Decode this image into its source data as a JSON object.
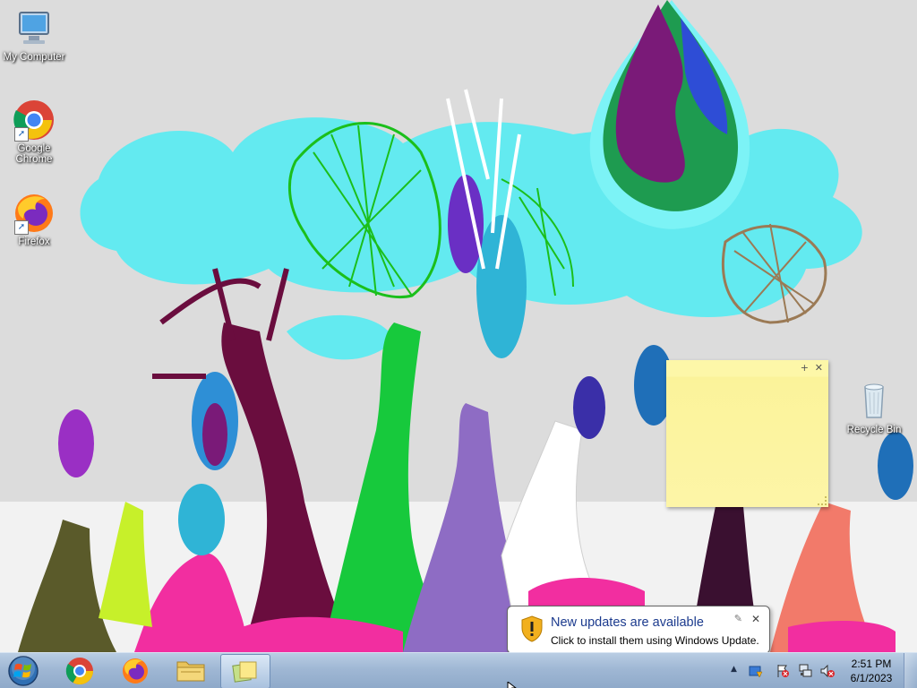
{
  "desktop": {
    "icons": [
      {
        "label": "My Computer",
        "icon": "computer-icon"
      },
      {
        "label": "Google Chrome",
        "icon": "chrome-icon"
      },
      {
        "label": "Firefox",
        "icon": "firefox-icon"
      },
      {
        "label": "Recycle Bin",
        "icon": "recycle-bin-icon"
      }
    ]
  },
  "balloon": {
    "title": "New updates are available",
    "body": "Click to install them using Windows Update.",
    "close_glyph": "✕",
    "icon": "shield-warning-icon"
  },
  "taskbar": {
    "start_icon": "windows-orb-icon",
    "pinned": [
      {
        "name": "Google Chrome",
        "icon": "chrome-icon"
      },
      {
        "name": "Firefox",
        "icon": "firefox-icon"
      },
      {
        "name": "Windows Explorer",
        "icon": "folder-icon"
      },
      {
        "name": "Sticky Notes",
        "icon": "sticky-notes-icon",
        "active": true
      }
    ],
    "tray": {
      "overflow_glyph": "▲",
      "icons": [
        "windows-update-icon",
        "action-center-icon",
        "network-icon",
        "volume-muted-icon"
      ],
      "time": "2:51 PM",
      "date": "6/1/2023"
    }
  },
  "colors": {
    "taskbar_top": "#b9cde3",
    "taskbar_bottom": "#8ea9c9",
    "sticky": "#fdf7a8",
    "balloon_title": "#1c3b8e"
  }
}
